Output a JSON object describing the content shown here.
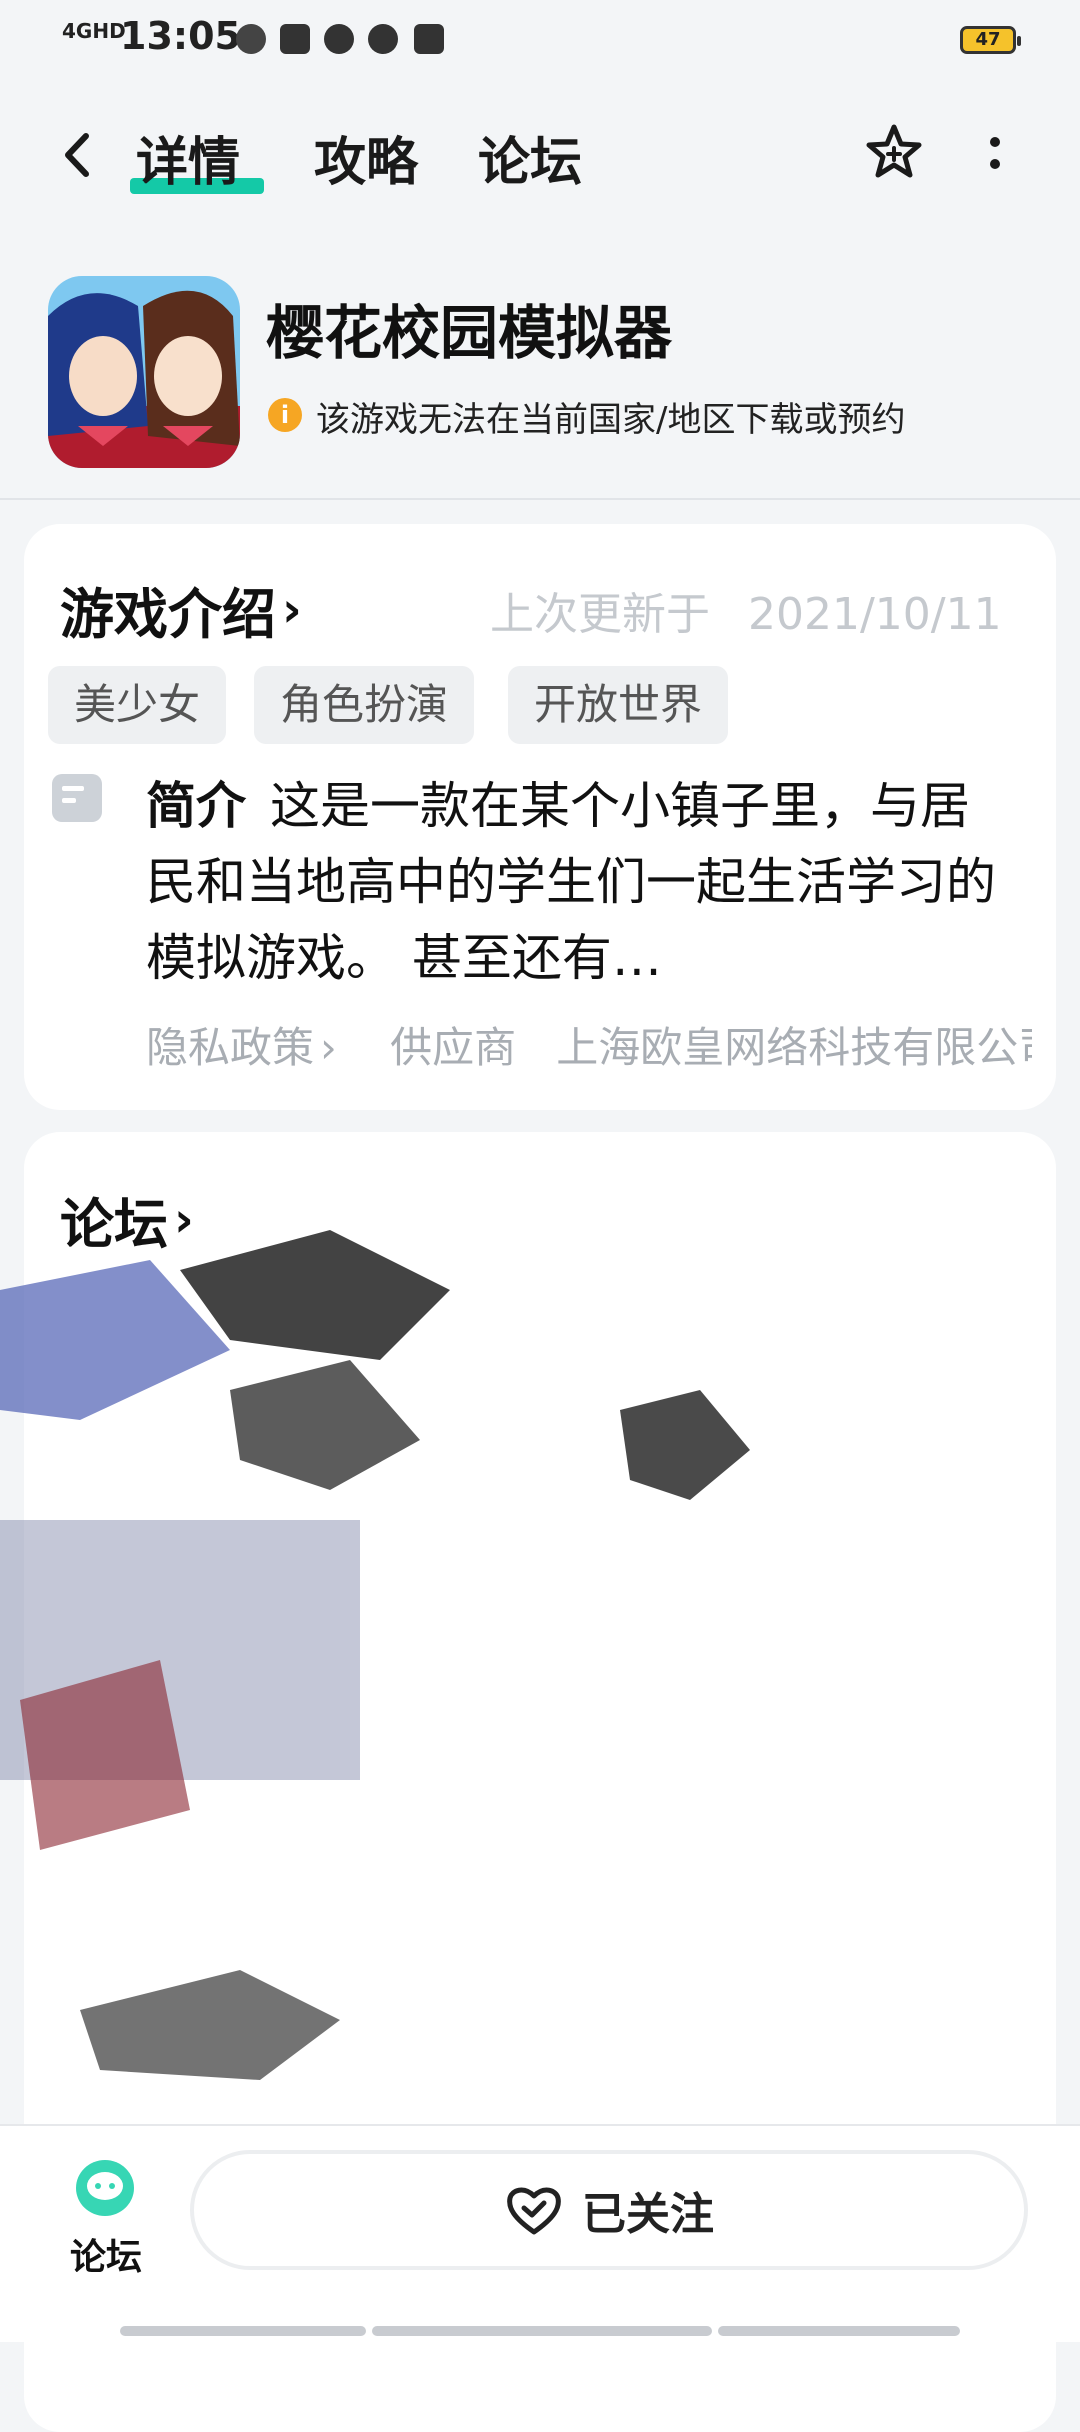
{
  "status_bar": {
    "network": "4GHD",
    "time": "13:05",
    "battery": "47",
    "icons": [
      "link-icon",
      "telegram-icon",
      "bot-icon",
      "wechat-icon",
      "card-icon"
    ]
  },
  "nav": {
    "tabs": [
      "详情",
      "攻略",
      "论坛"
    ],
    "active_tab": 0,
    "accent": "#14c9a7"
  },
  "game": {
    "title": "樱花校园模拟器",
    "warning": "该游戏无法在当前国家/地区下载或预约"
  },
  "intro_section": {
    "title": "游戏介绍",
    "chevron": "›",
    "updated_label": "上次更新于",
    "updated_date": "2021/10/11",
    "tags": [
      "美少女",
      "角色扮演",
      "开放世界"
    ],
    "summary_label": "简介",
    "summary_text": "这是一款在某个小镇子里，与居民和当地高中的学生们一起生活学习的模拟游戏。 甚至还有…",
    "privacy_label": "隐私政策",
    "privacy_chevron": "›",
    "vendor_label": "供应商",
    "vendor_name": "上海欧皇网络科技有限公司"
  },
  "forum_section": {
    "title": "论坛",
    "chevron": "›"
  },
  "bottom_bar": {
    "forum_label": "论坛",
    "follow_label": "已关注"
  }
}
